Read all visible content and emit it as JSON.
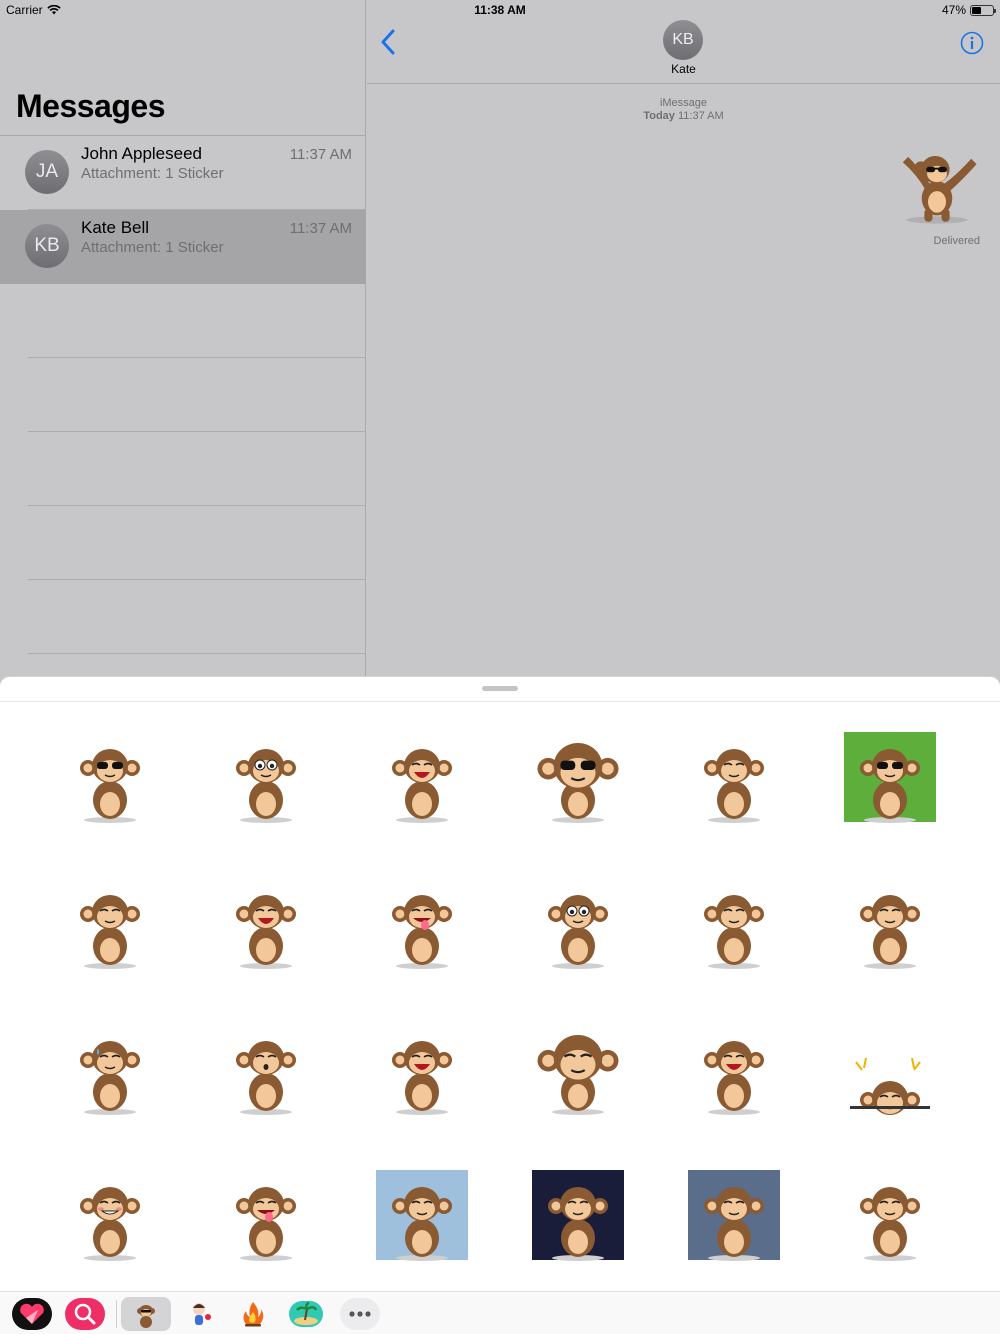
{
  "status_bar": {
    "carrier": "Carrier",
    "time": "11:38 AM",
    "battery_percent": "47%",
    "battery_level": 0.47,
    "wifi_icon": "wifi-icon"
  },
  "list": {
    "title": "Messages",
    "conversations": [
      {
        "initials": "JA",
        "name": "John Appleseed",
        "subtitle": "Attachment: 1 Sticker",
        "time": "11:37 AM",
        "selected": false
      },
      {
        "initials": "KB",
        "name": "Kate Bell",
        "subtitle": "Attachment: 1 Sticker",
        "time": "11:37 AM",
        "selected": true
      }
    ]
  },
  "conversation": {
    "contact_initials": "KB",
    "contact_name": "Kate",
    "service_label": "iMessage",
    "date_day": "Today",
    "date_time": "11:37 AM",
    "delivery_status": "Delivered",
    "back_icon": "chevron-left-icon",
    "info_icon": "info-icon",
    "accent_color": "#1a73e8"
  },
  "sticker_drawer": {
    "stickers": [
      "dab-sunglasses",
      "sparkle-eyes",
      "laugh-kick",
      "sunglasses-closeup",
      "knife-guard",
      "three-monkeys",
      "monkey-rooster",
      "angry-shout",
      "tongue-out",
      "thinking-thumb",
      "finger-cross",
      "happy-wave",
      "sweat-drop",
      "hands-hips",
      "fall-dizzy",
      "thumbs-up-closeup",
      "crying-laugh",
      "peek-sparkle",
      "blush-grin",
      "stretch-cheeks",
      "shower-cry",
      "night-scared",
      "gym-pose",
      "blank-stare"
    ],
    "tray_apps": [
      "heart-app-icon",
      "search-app-icon",
      "monkey-sticker-app-icon",
      "girl-sticker-app-icon",
      "fire-sticker-app-icon",
      "island-sticker-app-icon",
      "more-apps-icon"
    ]
  },
  "colors": {
    "background": "#c7c7c9",
    "selected_row": "#a5a5a7",
    "monkey_brown": "#8a5a33",
    "monkey_face": "#f2c89a"
  }
}
